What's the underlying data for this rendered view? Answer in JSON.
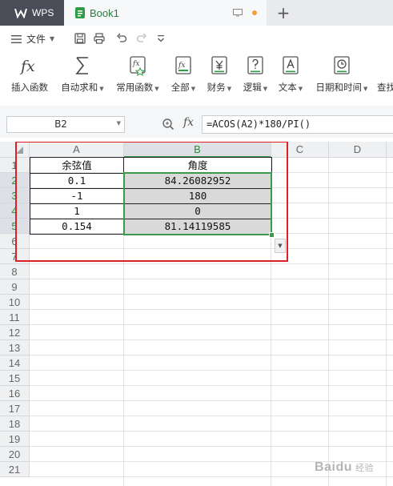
{
  "titlebar": {
    "app_label": "WPS",
    "doc_tab_label": "Book1"
  },
  "quickbar": {
    "menu_label": "文件"
  },
  "ribbon": {
    "items": [
      {
        "label": "插入函数",
        "has_caret": false
      },
      {
        "label": "自动求和",
        "has_caret": true
      },
      {
        "label": "常用函数",
        "has_caret": true
      },
      {
        "label": "全部",
        "has_caret": true
      },
      {
        "label": "财务",
        "has_caret": true
      },
      {
        "label": "逻辑",
        "has_caret": true
      },
      {
        "label": "文本",
        "has_caret": true
      },
      {
        "label": "日期和时间",
        "has_caret": true
      },
      {
        "label": "查找",
        "has_caret": false
      }
    ]
  },
  "formula_bar": {
    "cell_ref": "B2",
    "fx_label": "fx",
    "formula": "=ACOS(A2)*180/PI()"
  },
  "sheet": {
    "columns": [
      "A",
      "B",
      "C",
      "D"
    ],
    "selected_column": "B",
    "rows": [
      "1",
      "2",
      "3",
      "4",
      "5",
      "6",
      "7",
      "8",
      "9",
      "10",
      "11",
      "12",
      "13",
      "14",
      "15",
      "16",
      "17",
      "18",
      "19",
      "20",
      "21"
    ],
    "data": [
      {
        "a": "余弦值",
        "b": "角度"
      },
      {
        "a": "0.1",
        "b": "84.26082952"
      },
      {
        "a": "-1",
        "b": "180"
      },
      {
        "a": "1",
        "b": "0"
      },
      {
        "a": "0.154",
        "b": "81.14119585"
      }
    ]
  },
  "colors": {
    "accent_green": "#3a9b4a",
    "highlight_red": "#e02020",
    "selection_fill": "#d9d9d9"
  },
  "watermark": {
    "brand": "Baidu",
    "sub": "经验"
  }
}
